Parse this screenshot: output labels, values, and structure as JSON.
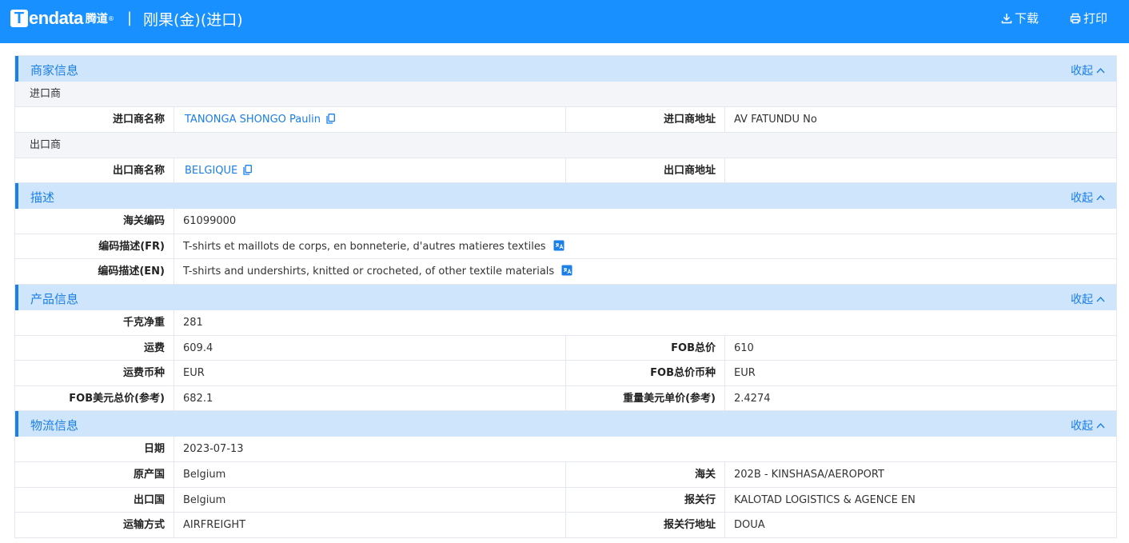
{
  "header": {
    "logo_text": "endata",
    "logo_letter": "T",
    "logo_cn": "腾道",
    "logo_reg": "®",
    "separator": "|",
    "title": "刚果(金)(进口)",
    "download_label": "下载",
    "print_label": "打印"
  },
  "collapse_label": "收起",
  "merchant": {
    "title": "商家信息",
    "importer_subhead": "进口商",
    "importer_name_label": "进口商名称",
    "importer_name": "TANONGA SHONGO Paulin",
    "importer_addr_label": "进口商地址",
    "importer_addr": "AV FATUNDU No",
    "exporter_subhead": "出口商",
    "exporter_name_label": "出口商名称",
    "exporter_name": "BELGIQUE",
    "exporter_addr_label": "出口商地址",
    "exporter_addr": ""
  },
  "description": {
    "title": "描述",
    "hs_label": "海关编码",
    "hs_code": "61099000",
    "desc_fr_label": "编码描述(FR)",
    "desc_fr": "T-shirts et maillots de corps, en bonneterie, d'autres matieres textiles",
    "desc_en_label": "编码描述(EN)",
    "desc_en": "T-shirts and undershirts, knitted or crocheted, of other textile materials"
  },
  "product": {
    "title": "产品信息",
    "net_kg_label": "千克净重",
    "net_kg": "281",
    "freight_label": "运费",
    "freight": "609.4",
    "fob_total_label": "FOB总价",
    "fob_total": "610",
    "freight_currency_label": "运费币种",
    "freight_currency": "EUR",
    "fob_currency_label": "FOB总价币种",
    "fob_currency": "EUR",
    "fob_usd_label": "FOB美元总价(参考)",
    "fob_usd": "682.1",
    "unit_usd_label": "重量美元单价(参考)",
    "unit_usd": "2.4274"
  },
  "logistics": {
    "title": "物流信息",
    "date_label": "日期",
    "date": "2023-07-13",
    "origin_label": "原产国",
    "origin": "Belgium",
    "customs_label": "海关",
    "customs": "202B - KINSHASA/AEROPORT",
    "export_country_label": "出口国",
    "export_country": "Belgium",
    "broker_label": "报关行",
    "broker": "KALOTAD LOGISTICS & AGENCE EN",
    "transport_label": "运输方式",
    "transport": "AIRFREIGHT",
    "broker_addr_label": "报关行地址",
    "broker_addr": "DOUA"
  },
  "colors": {
    "topbar": "#1890ff",
    "accent": "#1a7fe6",
    "section_bg": "#cfe5fb",
    "subhead_bg": "#f3f5f8"
  }
}
